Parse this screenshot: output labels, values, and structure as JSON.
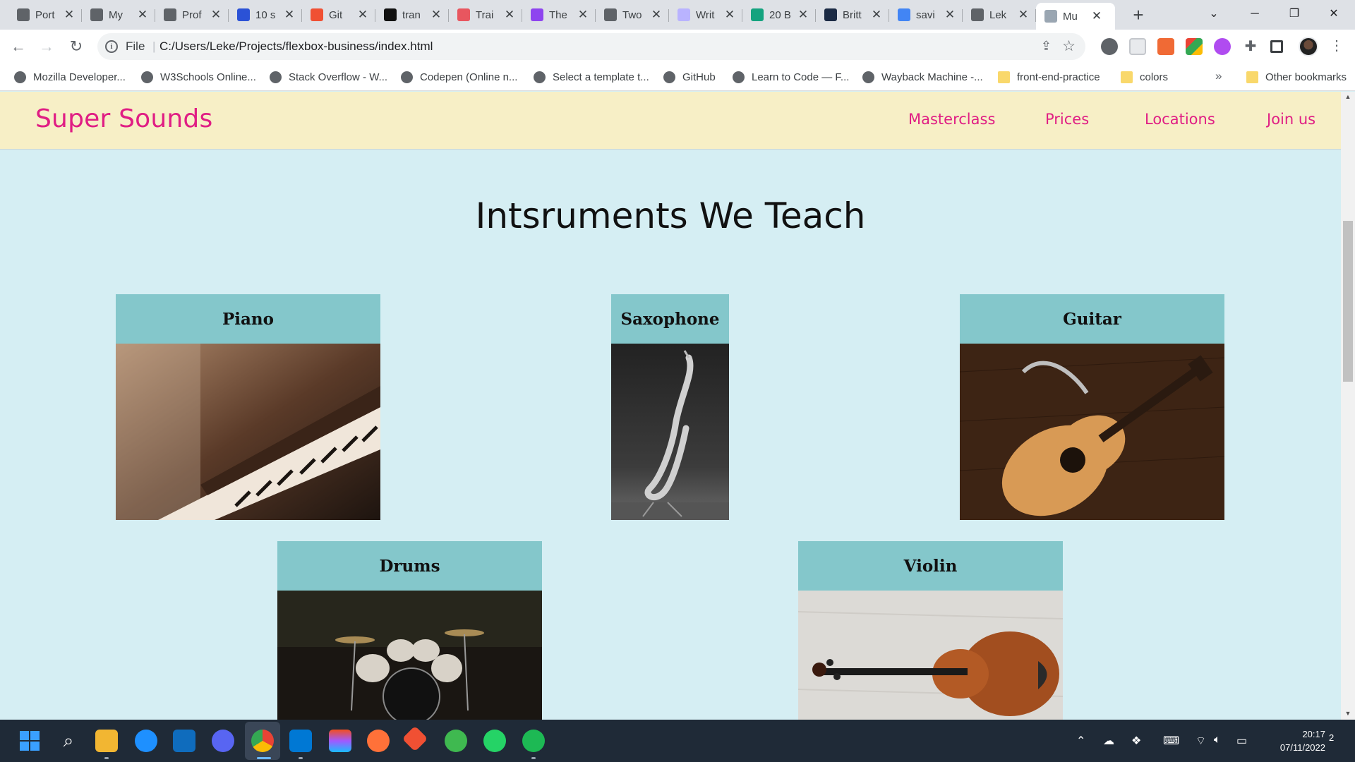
{
  "browser": {
    "tabs": [
      {
        "label": "Port",
        "icon": "document-icon",
        "color": "#5f6368"
      },
      {
        "label": "My",
        "icon": "globe-icon",
        "color": "#5f6368"
      },
      {
        "label": "Prof",
        "icon": "swirl-icon",
        "color": "#5f6368"
      },
      {
        "label": "10 s",
        "icon": "w-icon",
        "color": "#2b52d6"
      },
      {
        "label": "Git",
        "icon": "git-icon",
        "color": "#f05033"
      },
      {
        "label": "tran",
        "icon": "m-icon",
        "color": "#111111"
      },
      {
        "label": "Trai",
        "icon": "openai-icon",
        "color": "#e8565f"
      },
      {
        "label": "The",
        "icon": "u-icon",
        "color": "#8e44ef"
      },
      {
        "label": "Two",
        "icon": "curve-icon",
        "color": "#5f6368"
      },
      {
        "label": "Writ",
        "icon": "dash-icon",
        "color": "#b9b3ff"
      },
      {
        "label": "20 B",
        "icon": "grid-icon",
        "color": "#14a37f"
      },
      {
        "label": "Britt",
        "icon": "b-icon",
        "color": "#1b2a44"
      },
      {
        "label": "savi",
        "icon": "google-icon",
        "color": "#4285f4"
      },
      {
        "label": "Lek",
        "icon": "globe-icon",
        "color": "#5f6368"
      },
      {
        "label": "Mu",
        "icon": "building-icon",
        "color": "#9aa6b2",
        "active": true
      }
    ],
    "address_scheme": "File",
    "url": "C:/Users/Leke/Projects/flexbox-business/index.html",
    "bookmarks": [
      {
        "label": "Mozilla Developer...",
        "icon": "globe-icon"
      },
      {
        "label": "W3Schools Online...",
        "icon": "globe-icon"
      },
      {
        "label": "Stack Overflow - W...",
        "icon": "globe-icon"
      },
      {
        "label": "Codepen (Online n...",
        "icon": "star-icon"
      },
      {
        "label": "Select a template t...",
        "icon": "curve-icon"
      },
      {
        "label": "GitHub",
        "icon": "github-icon"
      },
      {
        "label": "Learn to Code — F...",
        "icon": "globe-icon"
      },
      {
        "label": "Wayback Machine -...",
        "icon": "archive-icon"
      },
      {
        "label": "front-end-practice",
        "icon": "folder-icon"
      },
      {
        "label": "colors",
        "icon": "folder-icon"
      }
    ],
    "bookmarks_more": "»",
    "other_bookmarks": "Other bookmarks"
  },
  "site": {
    "logo": "Super Sounds",
    "nav": [
      "Masterclass",
      "Prices",
      "Locations",
      "Join us"
    ],
    "section_title": "Intsruments We Teach",
    "instruments": [
      {
        "name": "Piano",
        "photo": "piano-photo"
      },
      {
        "name": "Saxophone",
        "photo": "saxophone-photo"
      },
      {
        "name": "Guitar",
        "photo": "guitar-photo"
      },
      {
        "name": "Drums",
        "photo": "drums-photo"
      },
      {
        "name": "Violin",
        "photo": "violin-photo"
      }
    ],
    "colors": {
      "accent": "#e01e84",
      "header_bg": "#f7efc6",
      "page_bg": "#d5eef3",
      "card_caption_bg": "#84c7cb"
    }
  },
  "taskbar": {
    "time": "20:17",
    "date": "07/11/2022",
    "notification_count": "2"
  }
}
